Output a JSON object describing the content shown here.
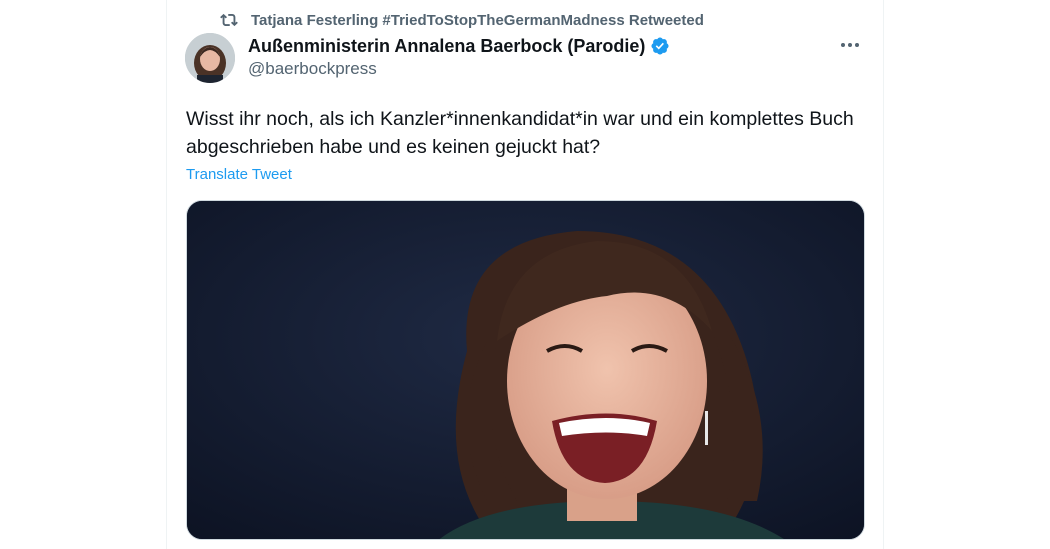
{
  "retweet": {
    "icon": "retweet-icon",
    "text": "Tatjana Festerling #TriedToStopTheGermanMadness Retweeted"
  },
  "author": {
    "name": "Außenministerin Annalena Baerbock (Parodie)",
    "handle": "@baerbockpress",
    "verified": true,
    "verified_color": "#1d9bf0"
  },
  "tweet": {
    "text": "Wisst ihr noch, als ich Kanzler*innenkandidat*in war und ein komplettes Buch abgeschrieben habe und es keinen gejuckt hat?",
    "translate_label": "Translate Tweet"
  },
  "colors": {
    "text": "#0f1419",
    "secondary": "#536471",
    "link": "#1d9bf0",
    "border": "#eff3f4",
    "media_bg": "#121a2e"
  }
}
